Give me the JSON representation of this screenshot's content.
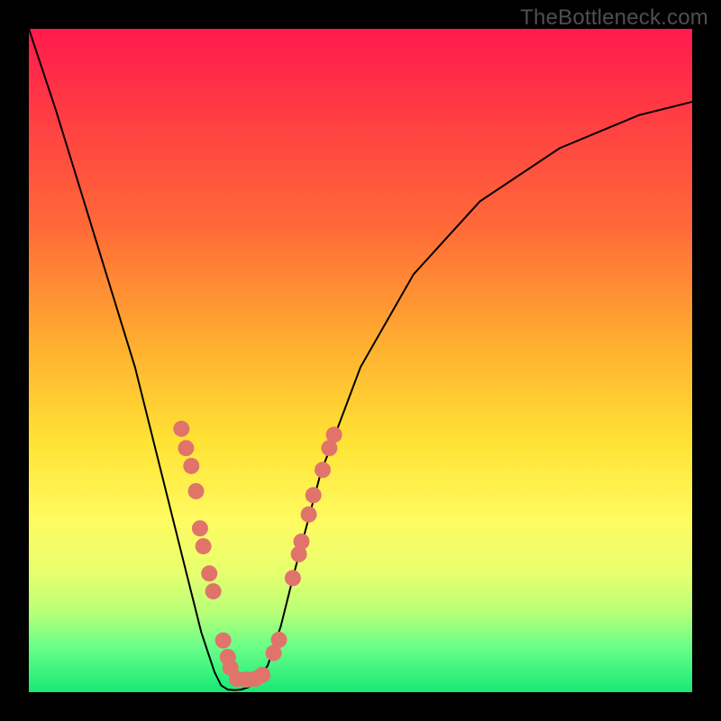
{
  "attribution": "TheBottleneck.com",
  "chart_data": {
    "type": "line",
    "title": "",
    "xlabel": "",
    "ylabel": "",
    "xlim": [
      0,
      100
    ],
    "ylim": [
      0,
      100
    ],
    "grid": false,
    "legend": false,
    "series": [
      {
        "name": "bottleneck-curve",
        "x": [
          0,
          4,
          8,
          12,
          16,
          20,
          22,
          24,
          26,
          27,
          28,
          29,
          30,
          31,
          32,
          33,
          34,
          36,
          38,
          40,
          44,
          50,
          58,
          68,
          80,
          92,
          100
        ],
        "y": [
          100,
          88,
          75,
          62,
          49,
          33,
          25,
          17,
          9,
          6,
          3,
          1,
          0.4,
          0.3,
          0.4,
          0.7,
          1.4,
          4,
          10,
          18,
          33,
          49,
          63,
          74,
          82,
          87,
          89
        ]
      }
    ],
    "markers": [
      {
        "x": 23.0,
        "y": 39.7
      },
      {
        "x": 23.7,
        "y": 36.8
      },
      {
        "x": 24.5,
        "y": 34.1
      },
      {
        "x": 25.2,
        "y": 30.3
      },
      {
        "x": 25.8,
        "y": 24.7
      },
      {
        "x": 26.3,
        "y": 22.0
      },
      {
        "x": 27.2,
        "y": 17.9
      },
      {
        "x": 27.8,
        "y": 15.2
      },
      {
        "x": 29.3,
        "y": 7.8
      },
      {
        "x": 30.0,
        "y": 5.3
      },
      {
        "x": 30.4,
        "y": 3.7
      },
      {
        "x": 31.4,
        "y": 2.0
      },
      {
        "x": 32.8,
        "y": 1.9
      },
      {
        "x": 34.1,
        "y": 2.0
      },
      {
        "x": 35.2,
        "y": 2.6
      },
      {
        "x": 36.9,
        "y": 5.9
      },
      {
        "x": 37.7,
        "y": 7.9
      },
      {
        "x": 39.8,
        "y": 17.2
      },
      {
        "x": 40.7,
        "y": 20.8
      },
      {
        "x": 41.1,
        "y": 22.7
      },
      {
        "x": 42.2,
        "y": 26.8
      },
      {
        "x": 42.9,
        "y": 29.7
      },
      {
        "x": 44.3,
        "y": 33.5
      },
      {
        "x": 45.3,
        "y": 36.8
      },
      {
        "x": 46.0,
        "y": 38.8
      }
    ],
    "marker_radius": 9,
    "curve_stroke": "#000000",
    "curve_width": 2
  }
}
